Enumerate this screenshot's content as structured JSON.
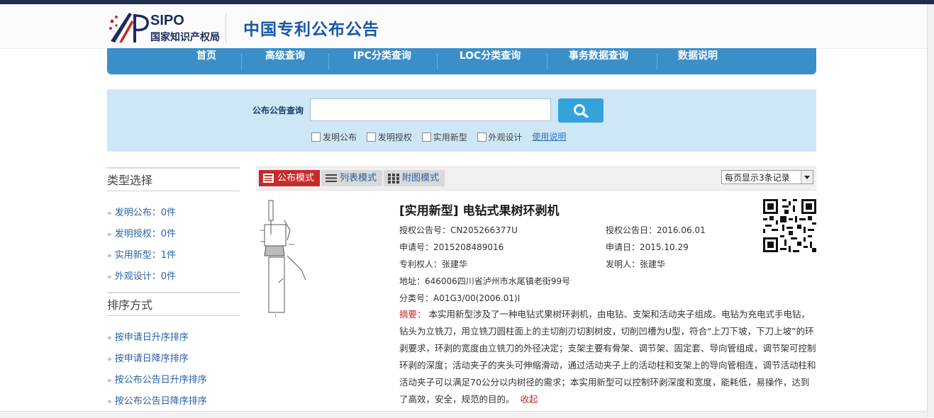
{
  "header": {
    "logo_text": "SIPO",
    "logo_subtitle": "国家知识产权局",
    "site_title": "中国专利公布公告"
  },
  "nav": {
    "items": [
      "首页",
      "高级查询",
      "IPC分类查询",
      "LOC分类查询",
      "事务数据查询",
      "数据说明"
    ]
  },
  "search": {
    "label": "公布公告查询",
    "value": "",
    "placeholder": "",
    "filters": [
      "发明公布",
      "发明授权",
      "实用新型",
      "外观设计"
    ],
    "help_link": "使用说明"
  },
  "sidebar": {
    "type_heading": "类型选择",
    "type_items": [
      "发明公布：0件",
      "发明授权：0件",
      "实用新型：1件",
      "外观设计：0件"
    ],
    "sort_heading": "排序方式",
    "sort_items": [
      "按申请日升序排序",
      "按申请日降序排序",
      "按公布公告日升序排序",
      "按公布公告日降序排序"
    ]
  },
  "toolbar": {
    "modes": [
      "公布模式",
      "列表模式",
      "附图模式"
    ],
    "active_mode": "公布模式",
    "per_page": "每页显示3条记录"
  },
  "result": {
    "title": "[实用新型] 电钻式果树环剥机",
    "grant_no": "授权公告号：CN205266377U",
    "grant_date": "授权公告日：2016.06.01",
    "app_no": "申请号：2015208489016",
    "app_date": "申请日：2015.10.29",
    "patentee": "专利权人：张建华",
    "inventor": "发明人：张建华",
    "address": "地址：646006四川省泸州市水尾镇老街99号",
    "classification": "分类号：A01G3/00(2006.01)I",
    "abstract_label": "摘要：",
    "abstract_text": "本实用新型涉及了一种电钻式果树环剥机，由电钻、支架和活动夹子组成。电钻为充电式手电钻，钻头为立铣刀，用立铣刀圆柱面上的主切削刃切割树皮，切削凹槽为U型，符合“上刀下坡，下刀上坡”的环剥要求，环剥的宽度由立铣刀的外径决定；支架主要有骨架、调节架、固定套、导向管组成，调节架可控制环剥的深度；活动夹子的夹头可伸缩滑动，通过活动夹子上的活动柱和支架上的导向管相连，调节活动柱和活动夹子可以满足70公分以内树径的需求；本实用新型可以控制环剥深度和宽度，能耗低，易操作，达到了高效，安全，规范的目的。",
    "collapse_label": "收起"
  },
  "colors": {
    "nav_bg": "#3a8fc9",
    "search_panel_bg": "#cde7f6",
    "active_mode": "#c62b2b",
    "link": "#2a60a8",
    "title_blue": "#1a58a8"
  }
}
